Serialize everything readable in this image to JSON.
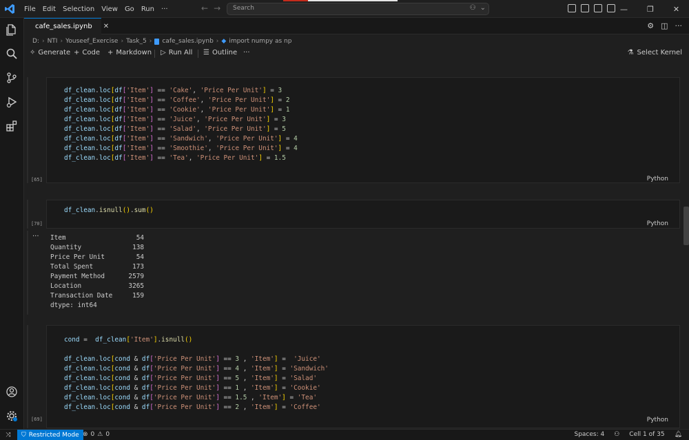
{
  "menu": [
    "File",
    "Edit",
    "Selection",
    "View",
    "Go",
    "Run",
    "···"
  ],
  "search": {
    "placeholder": "Search"
  },
  "tab": {
    "label": "cafe_sales.ipynb"
  },
  "breadcrumb": [
    "D:",
    "NTI",
    "Youseef_Exercise",
    "Task_5",
    "cafe_sales.ipynb",
    "import numpy as np"
  ],
  "toolbar": {
    "generate": "Generate",
    "code": "Code",
    "markdown": "Markdown",
    "run_all": "Run All",
    "outline": "Outline",
    "more": "···",
    "kernel": "Select Kernel"
  },
  "cells": [
    {
      "exec": "[65]",
      "lang": "Python"
    },
    {
      "exec": "[70]",
      "lang": "Python"
    },
    {
      "exec": "[69]",
      "lang": "Python"
    }
  ],
  "output": {
    "dots": "···",
    "rows": [
      {
        "name": "Item",
        "value": "54"
      },
      {
        "name": "Quantity",
        "value": "138"
      },
      {
        "name": "Price Per Unit",
        "value": "54"
      },
      {
        "name": "Total Spent",
        "value": "173"
      },
      {
        "name": "Payment Method",
        "value": "2579"
      },
      {
        "name": "Location",
        "value": "3265"
      },
      {
        "name": "Transaction Date",
        "value": "159"
      }
    ],
    "dtype": "dtype: int64"
  },
  "status": {
    "restricted": "Restricted Mode",
    "errors": "0",
    "warnings": "0",
    "spaces": "Spaces: 4",
    "cell": "Cell 1 of 35"
  },
  "colors": {
    "accent": "#0078d4",
    "editor_bg": "#1f1f1f"
  }
}
